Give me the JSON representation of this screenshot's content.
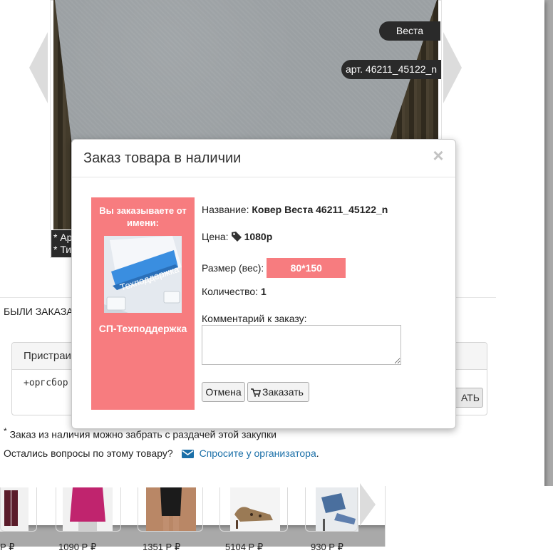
{
  "gallery": {
    "brand_tag": "Веста",
    "article_tag": "арт. 46211_45122_n",
    "caption_line1": "* Ар",
    "caption_line2": "* Ти"
  },
  "section": {
    "ordered_heading": "БЫЛИ ЗАКАЗА"
  },
  "background_panel": {
    "tab_label": "Пристраи",
    "code_text": "+оргсбор",
    "button_label": "АТЬ"
  },
  "note": {
    "asterisk": "*",
    "text": "Заказ из наличия можно забрать с раздачей этой закупки"
  },
  "ask": {
    "question": "Остались вопросы по этому товару?",
    "link": "Спросите у организатора",
    "tail": "."
  },
  "thumbnails": [
    {
      "price": "Р  ₽"
    },
    {
      "price": "1090 Р  ₽"
    },
    {
      "price": "1351 Р  ₽"
    },
    {
      "price": "5104 Р  ₽"
    },
    {
      "price": "930 Р  ₽"
    }
  ],
  "modal": {
    "title": "Заказ товара в наличии",
    "close_symbol": "×",
    "orderer_label": "Вы заказываете от имени:",
    "avatar_text": "Техподдержка",
    "orderer_name": "СП-Техподдержка",
    "name_label": "Название:",
    "name_value": "Ковер Веста 46211_45122_n",
    "price_label": "Цена:",
    "price_value": "1080р",
    "size_label": "Размер (вес):",
    "size_value": "80*150",
    "qty_label": "Количество:",
    "qty_value": "1",
    "comment_label": "Комментарий к заказу:",
    "comment_value": "",
    "cancel_label": "Отмена",
    "order_label": "Заказать"
  },
  "colors": {
    "accent": "#f77c7f",
    "link": "#1a6fa8",
    "tag_bg": "#2a2a2a"
  },
  "icons": {
    "price": "tag-icon",
    "order": "cart-icon",
    "ask": "envelope-icon",
    "close": "close-icon"
  }
}
